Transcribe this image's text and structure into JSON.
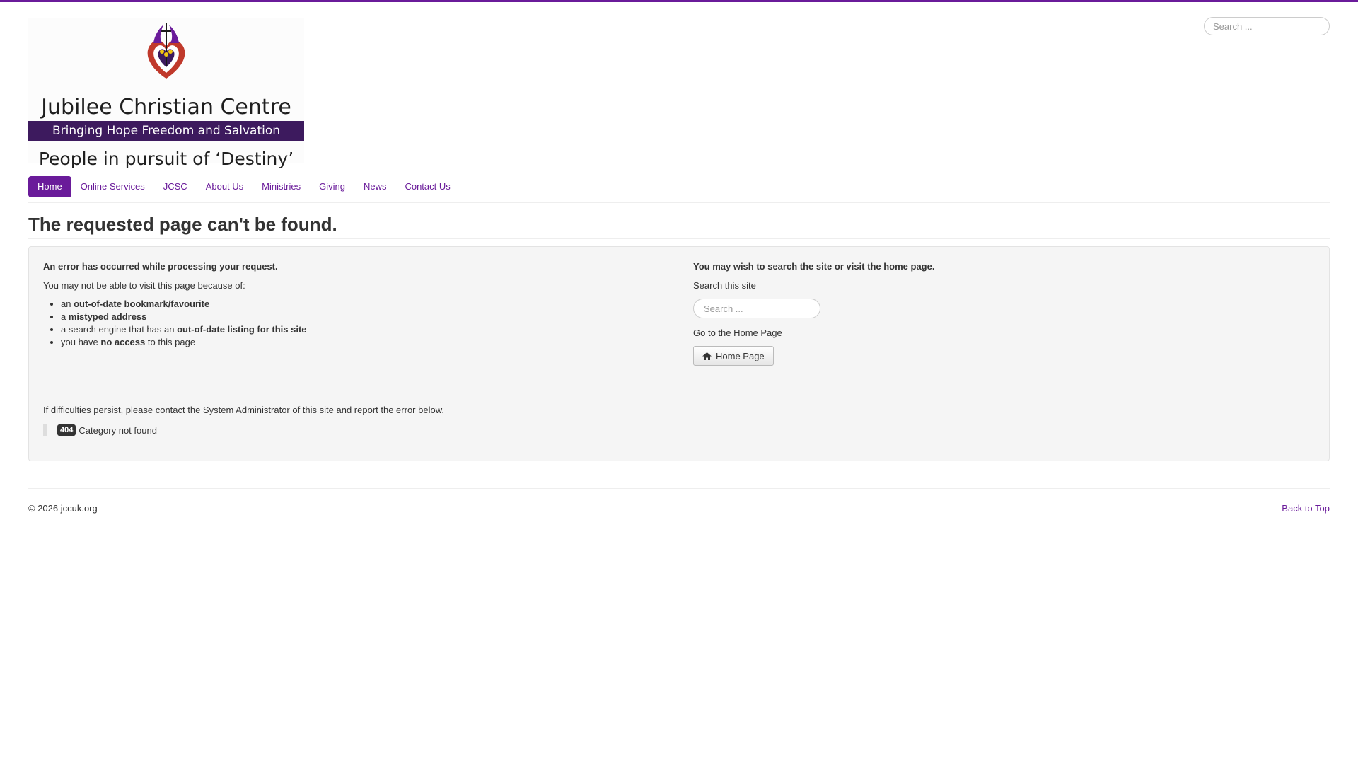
{
  "brand": {
    "title": "Jubilee Christian Centre",
    "tagline_bar": "Bringing Hope Freedom and Salvation",
    "motto": "People in pursuit of ‘Destiny’",
    "colors": {
      "accent": "#6a1b9a",
      "logo_bar": "#3d1a5e"
    }
  },
  "header_search": {
    "placeholder": "Search ..."
  },
  "nav": {
    "items": [
      {
        "label": "Home",
        "active": true
      },
      {
        "label": "Online Services"
      },
      {
        "label": "JCSC"
      },
      {
        "label": "About Us"
      },
      {
        "label": "Ministries"
      },
      {
        "label": "Giving"
      },
      {
        "label": "News"
      },
      {
        "label": "Contact Us"
      }
    ]
  },
  "page": {
    "title": "The requested page can't be found."
  },
  "error_panel": {
    "left": {
      "heading": "An error has occurred while processing your request.",
      "intro": "You may not be able to visit this page because of:",
      "reasons": [
        {
          "pre": "an ",
          "bold": "out-of-date bookmark/favourite",
          "post": ""
        },
        {
          "pre": "a ",
          "bold": "mistyped address",
          "post": ""
        },
        {
          "pre": "a search engine that has an ",
          "bold": "out-of-date listing for this site",
          "post": ""
        },
        {
          "pre": "you have ",
          "bold": "no access",
          "post": " to this page"
        }
      ]
    },
    "right": {
      "heading": "You may wish to search the site or visit the home page.",
      "search_label": "Search this site",
      "search_placeholder": "Search ...",
      "home_label": "Go to the Home Page",
      "home_button": "Home Page",
      "home_icon": "home-icon"
    },
    "persist_text": "If difficulties persist, please contact the System Administrator of this site and report the error below.",
    "error_code": "404",
    "error_message": "Category not found"
  },
  "footer": {
    "copyright": "© 2026 jccuk.org",
    "back_to_top": "Back to Top"
  }
}
